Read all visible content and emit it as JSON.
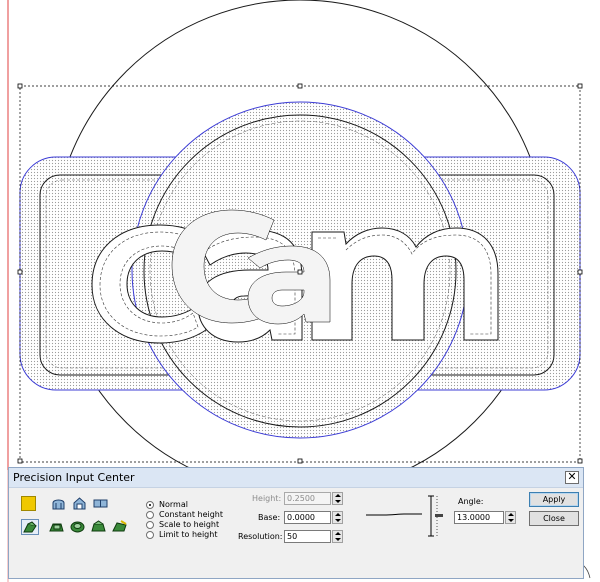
{
  "dialog": {
    "title": "Precision Input Center",
    "close_glyph": "✕",
    "tools_row1": [
      "color-swatch-icon",
      "dome-icon",
      "arch-icon",
      "flat-icon"
    ],
    "tools_row2": [
      "sweep-icon",
      "bevel-icon",
      "round-icon",
      "cone-icon",
      "wedge-icon"
    ],
    "modes": [
      {
        "label": "Normal",
        "checked": true
      },
      {
        "label": "Constant height",
        "checked": false
      },
      {
        "label": "Scale to height",
        "checked": false
      },
      {
        "label": "Limit to height",
        "checked": false
      }
    ],
    "height_label": "Height:",
    "height_value": "0.2500",
    "base_label": "Base:",
    "base_value": "0.0000",
    "resolution_label": "Resolution:",
    "resolution_value": "50",
    "angle_label": "Angle:",
    "angle_value": "13.0000",
    "apply_label": "Apply",
    "close_label": "Close"
  },
  "colors": {
    "selection_outline": "#3c3cd6",
    "shape_stroke": "#1a1a1a",
    "swatch": "#f0c800",
    "margin_line": "#e04040"
  }
}
